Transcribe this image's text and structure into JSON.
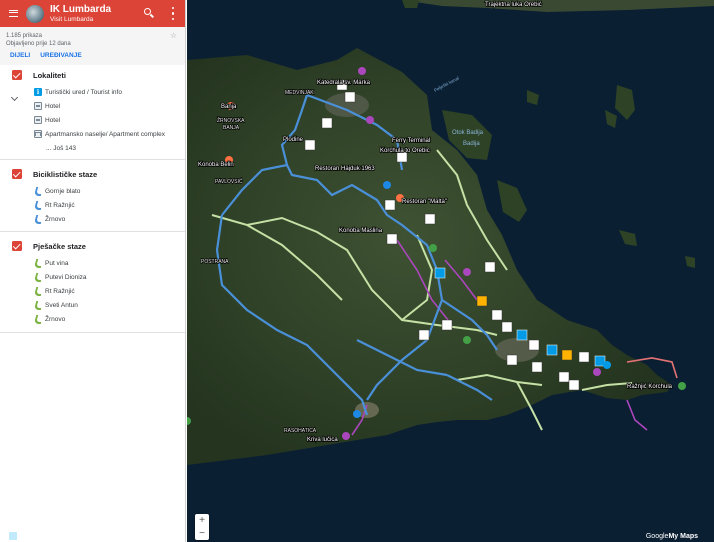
{
  "header": {
    "title": "IK Lumbarda",
    "owner": "Visit Lumbarda"
  },
  "info": {
    "views": "1.185 prikaza",
    "published": "Objavljeno prije 12 dana",
    "share_label": "DIJELI",
    "edit_label": "UREĐIVANJE"
  },
  "layers": [
    {
      "title": "Lokaliteti",
      "items": [
        {
          "label": "Turistički ured / Tourist info",
          "icon": "info-icon"
        },
        {
          "label": "Hotel",
          "icon": "hotel-icon"
        },
        {
          "label": "Hotel",
          "icon": "hotel-icon"
        },
        {
          "label": "Apartmansko naselje/ Apartment complex",
          "icon": "apartment-icon"
        }
      ],
      "more": "... Još 143"
    },
    {
      "title": "Biciklističke staze",
      "items": [
        {
          "label": "Gornje blato",
          "icon": "bike-route-icon"
        },
        {
          "label": "Rt Ražnjić",
          "icon": "bike-route-icon"
        },
        {
          "label": "Žrnovo",
          "icon": "bike-route-icon"
        }
      ]
    },
    {
      "title": "Pješačke staze",
      "items": [
        {
          "label": "Put vina",
          "icon": "hiking-route-icon"
        },
        {
          "label": "Putevi Dionizа",
          "icon": "hiking-route-icon"
        },
        {
          "label": "Rt Ražnjić",
          "icon": "hiking-route-icon"
        },
        {
          "label": "Sveti Antun",
          "icon": "hiking-route-icon"
        },
        {
          "label": "Žrnovo",
          "icon": "hiking-route-icon"
        }
      ]
    }
  ],
  "map": {
    "labels": {
      "trajektna": "Trajektna luka Orebić",
      "katedrala": "Katedrala sv. Marka",
      "medvinjak": "MEDVINJAK",
      "banja": "Banja",
      "zrnovska": "ŽRNOVSKA",
      "banja2": "BANJA",
      "plodine": "Plodine",
      "ferry": "Ferry Terminal",
      "korchula": "Korchula to Orebic",
      "hajduk": "Restoran Hajduk 1963",
      "malta": "Restoran \"Malta\"",
      "konoba_belin": "Konoba Belin",
      "pavlovsic": "PAVLOVSIĆ",
      "maslina": "Konoba Maslina",
      "postrana": "POSTRANA",
      "rasohatica": "RASOHATICA",
      "kriva": "Kriva lučica",
      "raznjic": "Ražnjić Korchula",
      "badija_lbl": "Otok Badija",
      "badija": "Badija",
      "channel": "Pelješki kanal",
      "pegle": "Pelješki kanal"
    },
    "zoom_in": "+",
    "zoom_out": "−",
    "attribution_brand": "Google",
    "attribution_product": "My Maps"
  },
  "colors": {
    "header": "#db4437",
    "bike_route": "#4a90d9",
    "hiking_route": "#c5e1a5",
    "wine_route": "#ab47bc",
    "accent": "#1a73e8"
  }
}
